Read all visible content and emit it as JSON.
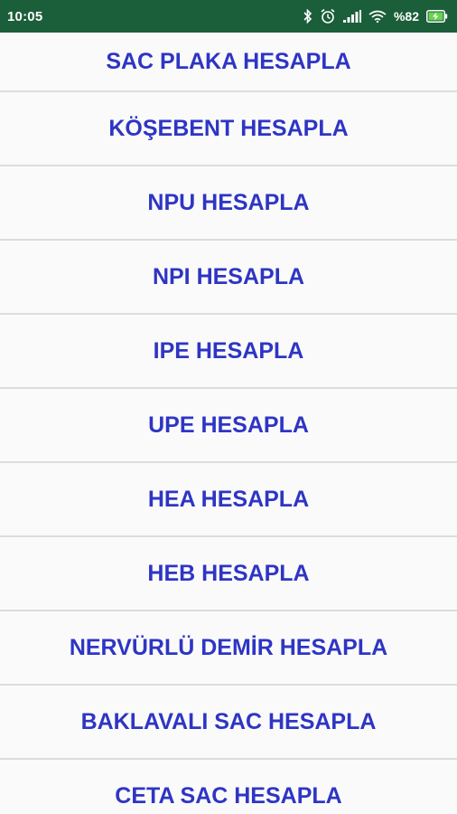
{
  "status_bar": {
    "time": "10:05",
    "battery_text": "%82",
    "icons": [
      "bluetooth-icon",
      "alarm-icon",
      "signal-icon",
      "wifi-icon",
      "battery-charging-icon"
    ],
    "background_color": "#1b5e3a",
    "battery_fill_color": "#6ad24f"
  },
  "menu": {
    "accent_color": "#2e35c4",
    "items": [
      {
        "label": "SAC PLAKA HESAPLA"
      },
      {
        "label": "KÖŞEBENT HESAPLA"
      },
      {
        "label": "NPU HESAPLA"
      },
      {
        "label": "NPI HESAPLA"
      },
      {
        "label": "IPE HESAPLA"
      },
      {
        "label": "UPE HESAPLA"
      },
      {
        "label": "HEA HESAPLA"
      },
      {
        "label": "HEB HESAPLA"
      },
      {
        "label": "NERVÜRLÜ DEMİR HESAPLA"
      },
      {
        "label": "BAKLAVALI SAC HESAPLA"
      },
      {
        "label": "CETA SAC HESAPLA"
      }
    ]
  }
}
